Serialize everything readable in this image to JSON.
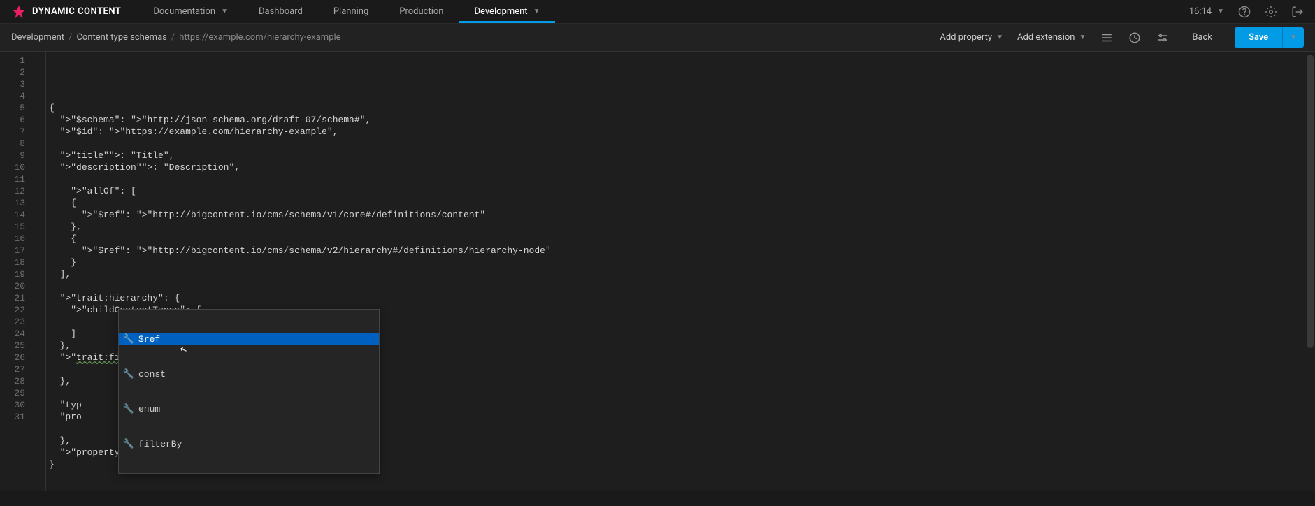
{
  "header": {
    "logo_text": "DYNAMIC CONTENT",
    "nav": [
      {
        "label": "Documentation",
        "dropdown": true
      },
      {
        "label": "Dashboard"
      },
      {
        "label": "Planning"
      },
      {
        "label": "Production"
      },
      {
        "label": "Development",
        "active": true,
        "dropdown": true
      }
    ],
    "time": "16:14"
  },
  "toolbar": {
    "breadcrumb": {
      "root": "Development",
      "section": "Content type schemas",
      "path": "https://example.com/hierarchy-example"
    },
    "add_property": "Add property",
    "add_extension": "Add extension",
    "back": "Back",
    "save": "Save"
  },
  "editor": {
    "lines": [
      "{",
      "  \"$schema\": \"http://json-schema.org/draft-07/schema#\",",
      "  \"$id\": \"https://example.com/hierarchy-example\",",
      "",
      "  \"title\": \"Title\",",
      "  \"description\": \"Description\",",
      "",
      "    \"allOf\": [",
      "    {",
      "      \"$ref\": \"http://bigcontent.io/cms/schema/v1/core#/definitions/content\"",
      "    },",
      "    {",
      "      \"$ref\": \"http://bigcontent.io/cms/schema/v2/hierarchy#/definitions/hierarchy-node\"",
      "    }",
      "  ],",
      "",
      "  \"trait:hierarchy\": {",
      "    \"childContentTypes\": [",
      "",
      "    ]",
      "  },",
      "  \"trait:filterable\": {",
      "",
      "  },",
      "",
      "  \"typ",
      "  \"pro",
      "",
      "  },",
      "  \"propertyOrder\": []",
      "}"
    ],
    "line_count": 31
  },
  "autocomplete": {
    "items": [
      {
        "label": "$ref",
        "selected": true
      },
      {
        "label": "const"
      },
      {
        "label": "enum"
      },
      {
        "label": "filterBy"
      }
    ]
  }
}
